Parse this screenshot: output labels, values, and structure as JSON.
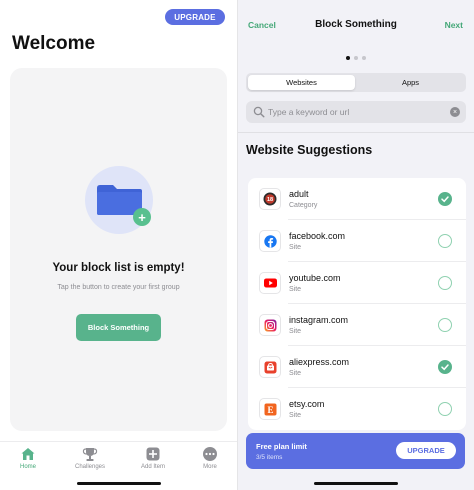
{
  "left": {
    "upgrade_label": "UPGRADE",
    "title": "Welcome",
    "empty_title": "Your block list is empty!",
    "empty_subtitle": "Tap the button to create your first group",
    "block_button_label": "Block Something",
    "tabs": [
      {
        "label": "Home",
        "icon": "home-icon"
      },
      {
        "label": "Challenges",
        "icon": "trophy-icon"
      },
      {
        "label": "Add Item",
        "icon": "add-icon"
      },
      {
        "label": "More",
        "icon": "more-icon"
      }
    ]
  },
  "right": {
    "nav": {
      "cancel_label": "Cancel",
      "title": "Block Something",
      "next_label": "Next"
    },
    "segments": [
      "Websites",
      "Apps"
    ],
    "search": {
      "placeholder": "Type a keyword or url"
    },
    "section_title": "Website Suggestions",
    "items": [
      {
        "name": "adult",
        "type": "Category",
        "icon": "adult-18-icon",
        "selected": true
      },
      {
        "name": "facebook.com",
        "type": "Site",
        "icon": "facebook-icon",
        "selected": false
      },
      {
        "name": "youtube.com",
        "type": "Site",
        "icon": "youtube-icon",
        "selected": false
      },
      {
        "name": "instagram.com",
        "type": "Site",
        "icon": "instagram-icon",
        "selected": false
      },
      {
        "name": "aliexpress.com",
        "type": "Site",
        "icon": "aliexpress-icon",
        "selected": true
      },
      {
        "name": "etsy.com",
        "type": "Site",
        "icon": "etsy-icon",
        "selected": false
      }
    ],
    "plan": {
      "title": "Free plan limit",
      "count": "3/5 items",
      "upgrade_label": "UPGRADE"
    }
  },
  "colors": {
    "accent_green": "#58b38c",
    "accent_blue": "#5b6ee1"
  }
}
